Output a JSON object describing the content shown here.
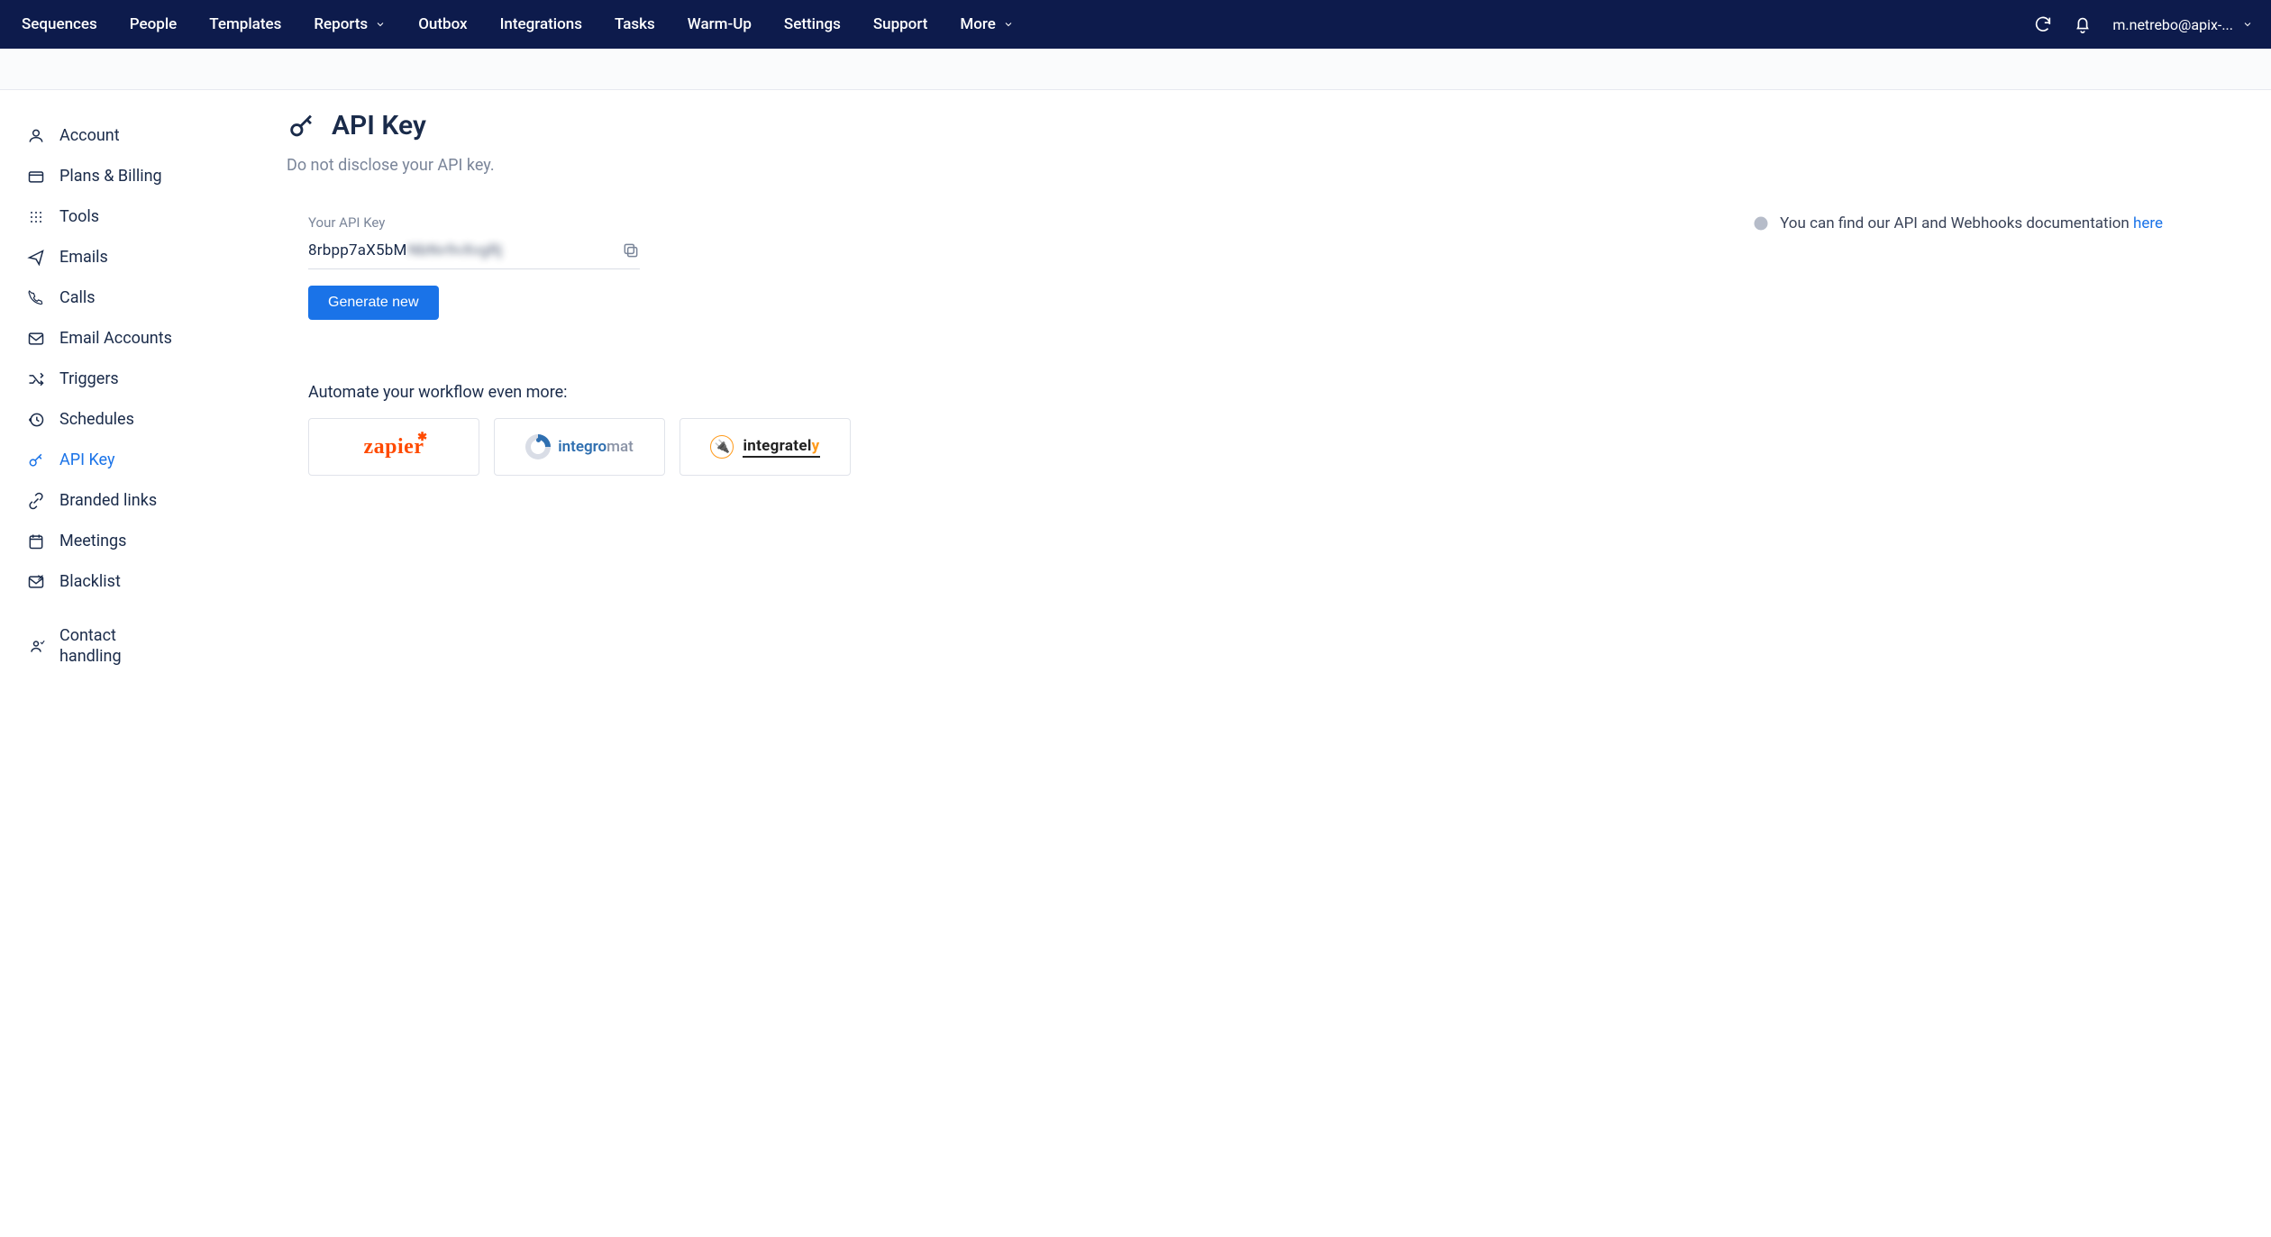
{
  "nav": {
    "items": [
      "Sequences",
      "People",
      "Templates",
      "Reports",
      "Outbox",
      "Integrations",
      "Tasks",
      "Warm-Up",
      "Settings",
      "Support",
      "More"
    ],
    "account_email": "m.netrebo@apix-..."
  },
  "sidebar": {
    "items": [
      {
        "label": "Account",
        "icon": "user"
      },
      {
        "label": "Plans & Billing",
        "icon": "card"
      },
      {
        "label": "Tools",
        "icon": "grid"
      },
      {
        "label": "Emails",
        "icon": "send"
      },
      {
        "label": "Calls",
        "icon": "phone"
      },
      {
        "label": "Email Accounts",
        "icon": "mail"
      },
      {
        "label": "Triggers",
        "icon": "shuffle"
      },
      {
        "label": "Schedules",
        "icon": "history"
      },
      {
        "label": "API Key",
        "icon": "key",
        "active": true
      },
      {
        "label": "Branded links",
        "icon": "link"
      },
      {
        "label": "Meetings",
        "icon": "calendar"
      },
      {
        "label": "Blacklist",
        "icon": "mailx"
      },
      {
        "label": "Contact handling",
        "icon": "contact"
      }
    ]
  },
  "page": {
    "title": "API Key",
    "subtitle": "Do not disclose your API key.",
    "field_label": "Your API Key",
    "key_visible": "8rbpp7aX5bM",
    "key_hidden": "NbNv9vXvgRj",
    "generate_label": "Generate new",
    "doc_text": "You can find our API and Webhooks documentation ",
    "doc_link": "here",
    "automate_title": "Automate your workflow even more:",
    "integrations": [
      {
        "name": "zapier",
        "label": "zapier"
      },
      {
        "name": "integromat",
        "label_a": "integro",
        "label_b": "mat"
      },
      {
        "name": "integrately",
        "label": "integratel",
        "label_y": "y"
      }
    ]
  }
}
